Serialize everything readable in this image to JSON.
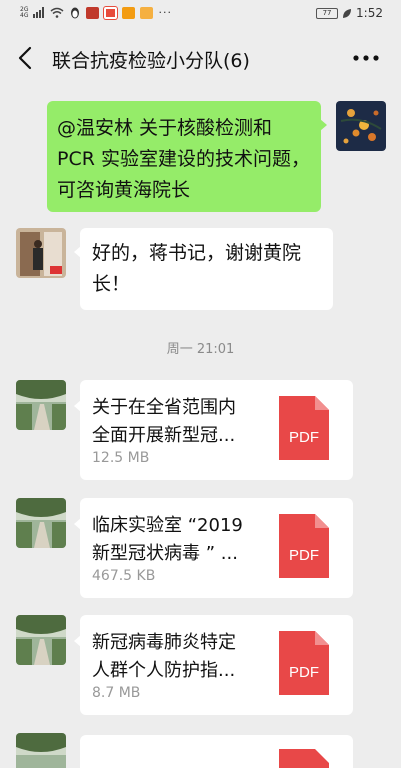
{
  "status_bar": {
    "network": "2G",
    "network2": "4G",
    "battery": "77",
    "time": "1:52",
    "more": "···"
  },
  "nav": {
    "title": "联合抗疫检验小分队(6)"
  },
  "messages": [
    {
      "side": "right",
      "text_lines": [
        "@温安林  关于核酸检测和",
        "PCR 实验室建设的技术问题，",
        "可咨询黄海院长"
      ]
    },
    {
      "side": "left",
      "text_lines": [
        "好的，蒋书记，谢谢黄院",
        "长！"
      ]
    }
  ],
  "timestamp": "周一 21:01",
  "files": [
    {
      "name_lines": [
        "关于在全省范围内",
        "全面开展新型冠..."
      ],
      "size": "12.5 MB",
      "type_label": "PDF"
    },
    {
      "name_lines": [
        "临床实验室 “2019",
        "新型冠状病毒 ” ..."
      ],
      "size": "467.5 KB",
      "type_label": "PDF"
    },
    {
      "name_lines": [
        "新冠病毒肺炎特定",
        "人群个人防护指..."
      ],
      "size": "8.7 MB",
      "type_label": "PDF"
    }
  ],
  "colors": {
    "background": "#ededed",
    "sent_bubble": "#95ec69",
    "received_bubble": "#ffffff",
    "pdf_red": "#e84848"
  }
}
